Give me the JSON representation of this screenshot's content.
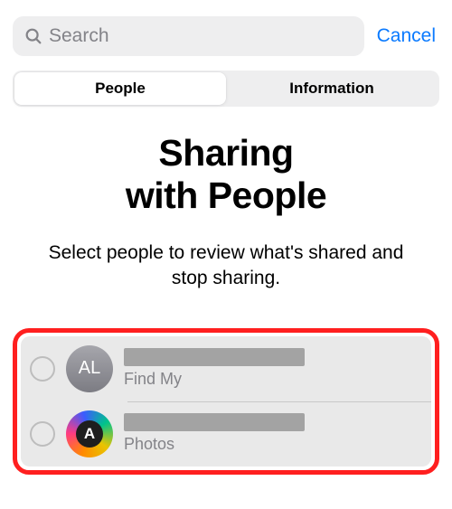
{
  "search": {
    "placeholder": "Search"
  },
  "cancel_label": "Cancel",
  "segments": {
    "people": "People",
    "information": "Information",
    "active": "people"
  },
  "title_line1": "Sharing",
  "title_line2": "with People",
  "subtitle": "Select people to review what's shared and stop sharing.",
  "rows": [
    {
      "avatar_text": "AL",
      "app": "Find My"
    },
    {
      "avatar_text": "A",
      "app": "Photos"
    }
  ]
}
